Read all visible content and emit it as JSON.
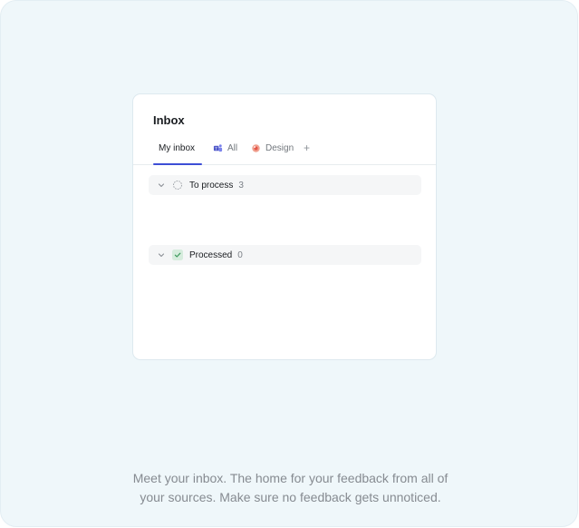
{
  "inbox": {
    "title": "Inbox",
    "tabs": [
      {
        "label": "My inbox",
        "icon": "none",
        "active": true
      },
      {
        "label": "All",
        "icon": "teams-icon",
        "active": false
      },
      {
        "label": "Design",
        "icon": "design-icon",
        "active": false
      }
    ],
    "add_tab_symbol": "+",
    "groups": [
      {
        "label": "To process",
        "count": "3",
        "icon": "circle-dashed-icon"
      },
      {
        "label": "Processed",
        "count": "0",
        "icon": "check-icon"
      }
    ]
  },
  "caption": {
    "line1": "Meet your inbox. The home for your feedback from all of",
    "line2": "your sources. Make sure no feedback gets unnoticed."
  },
  "colors": {
    "background": "#eff7fa",
    "accent": "#3d4ed6",
    "processed_green": "#3d9a5c"
  }
}
